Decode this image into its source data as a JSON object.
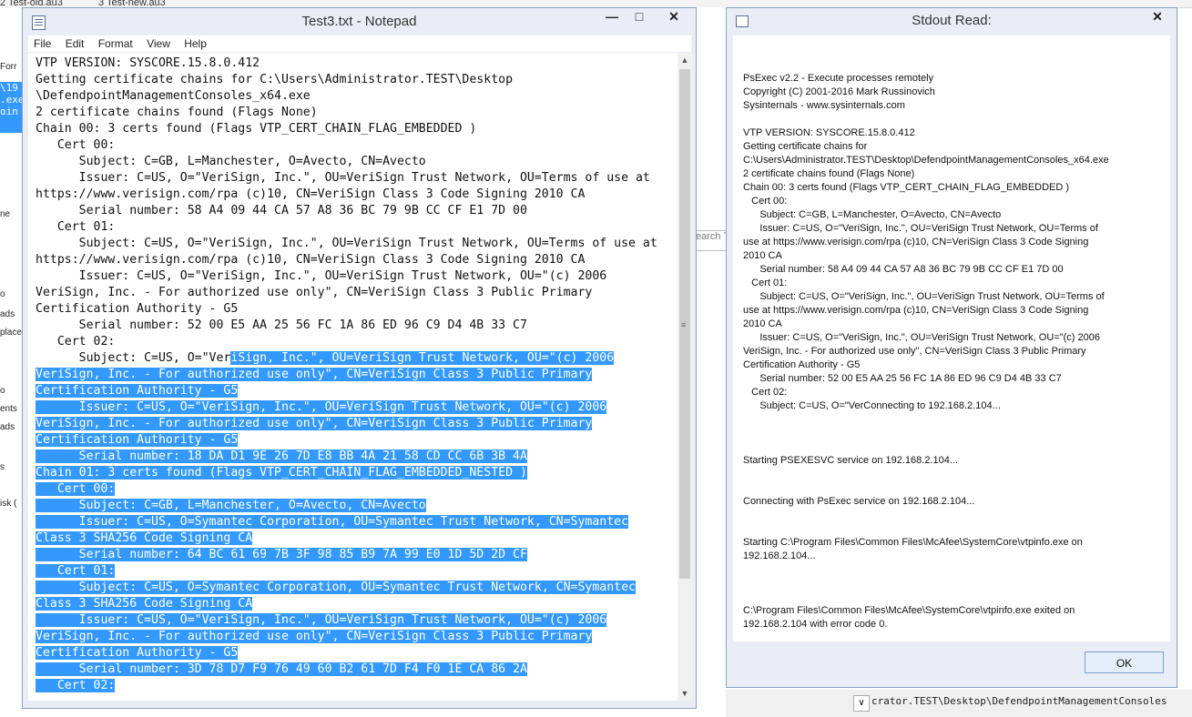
{
  "background": {
    "tabs": [
      "2 Test-old.au3",
      "3 Test-new.au3"
    ],
    "left_fragments": [
      "Forr",
      "\\19",
      ".exe",
      "oin",
      "ne",
      "o",
      "ads",
      "place",
      "o",
      "ents",
      "ads",
      "s",
      "isk ("
    ],
    "search_placeholder": "earch T",
    "bottom_path": "crator.TEST\\Desktop\\DefendpointManagementConsoles"
  },
  "notepad": {
    "title": "Test3.txt - Notepad",
    "controls": {
      "minimize": "—",
      "maximize": "□",
      "close": "✕"
    },
    "menu": [
      "File",
      "Edit",
      "Format",
      "View",
      "Help"
    ],
    "text_plain": "VTP VERSION: SYSCORE.15.8.0.412\nGetting certificate chains for C:\\Users\\Administrator.TEST\\Desktop\n\\DefendpointManagementConsoles_x64.exe\n2 certificate chains found (Flags None)\nChain 00: 3 certs found (Flags VTP_CERT_CHAIN_FLAG_EMBEDDED )\n   Cert 00:\n      Subject: C=GB, L=Manchester, O=Avecto, CN=Avecto\n      Issuer: C=US, O=\"VeriSign, Inc.\", OU=VeriSign Trust Network, OU=Terms of use at\nhttps://www.verisign.com/rpa (c)10, CN=VeriSign Class 3 Code Signing 2010 CA\n      Serial number: 58 A4 09 44 CA 57 A8 36 BC 79 9B CC CF E1 7D 00\n   Cert 01:\n      Subject: C=US, O=\"VeriSign, Inc.\", OU=VeriSign Trust Network, OU=Terms of use at\nhttps://www.verisign.com/rpa (c)10, CN=VeriSign Class 3 Code Signing 2010 CA\n      Issuer: C=US, O=\"VeriSign, Inc.\", OU=VeriSign Trust Network, OU=\"(c) 2006\nVeriSign, Inc. - For authorized use only\", CN=VeriSign Class 3 Public Primary\nCertification Authority - G5\n      Serial number: 52 00 E5 AA 25 56 FC 1A 86 ED 96 C9 D4 4B 33 C7\n   Cert 02:\n      Subject: C=US, O=\"Ver",
    "text_selected": "iSign, Inc.\", OU=VeriSign Trust Network, OU=\"(c) 2006\nVeriSign, Inc. - For authorized use only\", CN=VeriSign Class 3 Public Primary\nCertification Authority - G5\n      Issuer: C=US, O=\"VeriSign, Inc.\", OU=VeriSign Trust Network, OU=\"(c) 2006\nVeriSign, Inc. - For authorized use only\", CN=VeriSign Class 3 Public Primary\nCertification Authority - G5\n      Serial number: 18 DA D1 9E 26 7D E8 BB 4A 21 58 CD CC 6B 3B 4A\nChain 01: 3 certs found (Flags VTP_CERT_CHAIN_FLAG_EMBEDDED_NESTED )\n   Cert 00:\n      Subject: C=GB, L=Manchester, O=Avecto, CN=Avecto\n      Issuer: C=US, O=Symantec Corporation, OU=Symantec Trust Network, CN=Symantec\nClass 3 SHA256 Code Signing CA\n      Serial number: 64 BC 61 69 7B 3F 98 85 B9 7A 99 E0 1D 5D 2D CF\n   Cert 01:\n      Subject: C=US, O=Symantec Corporation, OU=Symantec Trust Network, CN=Symantec\nClass 3 SHA256 Code Signing CA\n      Issuer: C=US, O=\"VeriSign, Inc.\", OU=VeriSign Trust Network, OU=\"(c) 2006\nVeriSign, Inc. - For authorized use only\", CN=VeriSign Class 3 Public Primary\nCertification Authority - G5\n      Serial number: 3D 78 D7 F9 76 49 60 B2 61 7D F4 F0 1E CA 86 2A\n   Cert 02:",
    "selection_color": "#3399ff"
  },
  "stdout": {
    "title": "Stdout Read:",
    "close": "✕",
    "ok_label": "OK",
    "text": "PsExec v2.2 - Execute processes remotely\nCopyright (C) 2001-2016 Mark Russinovich\nSysinternals - www.sysinternals.com\n\nVTP VERSION: SYSCORE.15.8.0.412\nGetting certificate chains for\nC:\\Users\\Administrator.TEST\\Desktop\\DefendpointManagementConsoles_x64.exe\n2 certificate chains found (Flags None)\nChain 00: 3 certs found (Flags VTP_CERT_CHAIN_FLAG_EMBEDDED )\n   Cert 00:\n      Subject: C=GB, L=Manchester, O=Avecto, CN=Avecto\n      Issuer: C=US, O=\"VeriSign, Inc.\", OU=VeriSign Trust Network, OU=Terms of\nuse at https://www.verisign.com/rpa (c)10, CN=VeriSign Class 3 Code Signing\n2010 CA\n      Serial number: 58 A4 09 44 CA 57 A8 36 BC 79 9B CC CF E1 7D 00\n   Cert 01:\n      Subject: C=US, O=\"VeriSign, Inc.\", OU=VeriSign Trust Network, OU=Terms of\nuse at https://www.verisign.com/rpa (c)10, CN=VeriSign Class 3 Code Signing\n2010 CA\n      Issuer: C=US, O=\"VeriSign, Inc.\", OU=VeriSign Trust Network, OU=\"(c) 2006\nVeriSign, Inc. - For authorized use only\", CN=VeriSign Class 3 Public Primary\nCertification Authority - G5\n      Serial number: 52 00 E5 AA 25 56 FC 1A 86 ED 96 C9 D4 4B 33 C7\n   Cert 02:\n      Subject: C=US, O=\"VerConnecting to 192.168.2.104...\n\n\n\nStarting PSEXESVC service on 192.168.2.104...\n\n\nConnecting with PsExec service on 192.168.2.104...\n\n\nStarting C:\\Program Files\\Common Files\\McAfee\\SystemCore\\vtpinfo.exe on\n192.168.2.104...\n\n\n\nC:\\Program Files\\Common Files\\McAfee\\SystemCore\\vtpinfo.exe exited on\n192.168.2.104 with error code 0."
  }
}
